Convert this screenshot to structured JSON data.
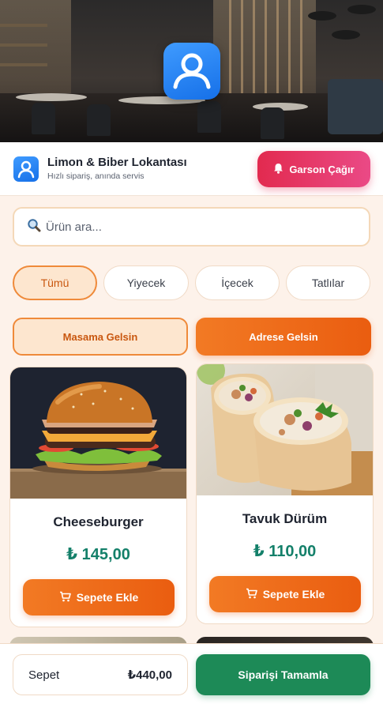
{
  "restaurant": {
    "name": "Limon & Biber Lokantası",
    "tagline": "Hızlı sipariş, anında servis"
  },
  "header": {
    "call_waiter_label": "Garson Çağır"
  },
  "search": {
    "placeholder": "Ürün ara..."
  },
  "categories": [
    {
      "label": "Tümü",
      "active": true
    },
    {
      "label": "Yiyecek",
      "active": false
    },
    {
      "label": "İçecek",
      "active": false
    },
    {
      "label": "Tatlılar",
      "active": false
    }
  ],
  "delivery": {
    "table_label": "Masama Gelsin",
    "address_label": "Adrese Gelsin",
    "selected": "address"
  },
  "products": [
    {
      "name": "Cheeseburger",
      "price": "₺ 145,00",
      "button": "Sepete Ekle",
      "image": "burger-photo"
    },
    {
      "name": "Tavuk Dürüm",
      "price": "₺ 110,00",
      "button": "Sepete Ekle",
      "image": "wrap-photo"
    }
  ],
  "cart": {
    "label": "Sepet",
    "total": "₺440,00",
    "checkout_label": "Siparişi Tamamla"
  },
  "colors": {
    "accent": "#ea5d10",
    "price": "#14806a",
    "waiter": "#e22a4f",
    "checkout": "#1d8a57",
    "logo": "#1670e8"
  }
}
